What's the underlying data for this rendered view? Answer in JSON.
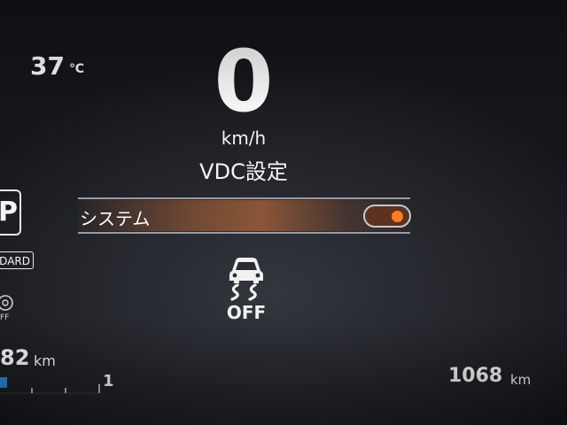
{
  "status": {
    "temperature_value": "37",
    "temperature_unit": "℃"
  },
  "speedometer": {
    "speed_value": "0",
    "speed_unit": "km/h"
  },
  "vdc_menu": {
    "title": "VDC設定",
    "item_label": "システム",
    "item_toggle_state": "on",
    "toggle_color": "#ff7d2a",
    "indicator_icon": "vdc-off-icon",
    "indicator_text": "OFF"
  },
  "left_panel": {
    "p_label": "P",
    "board_label": "DARD",
    "off_label": "FF"
  },
  "trip": {
    "range_value": "82",
    "range_unit": "km",
    "bar_end_label": "1",
    "bar_color": "#2f7fd6"
  },
  "odometer": {
    "value": "1068",
    "unit": "km"
  }
}
